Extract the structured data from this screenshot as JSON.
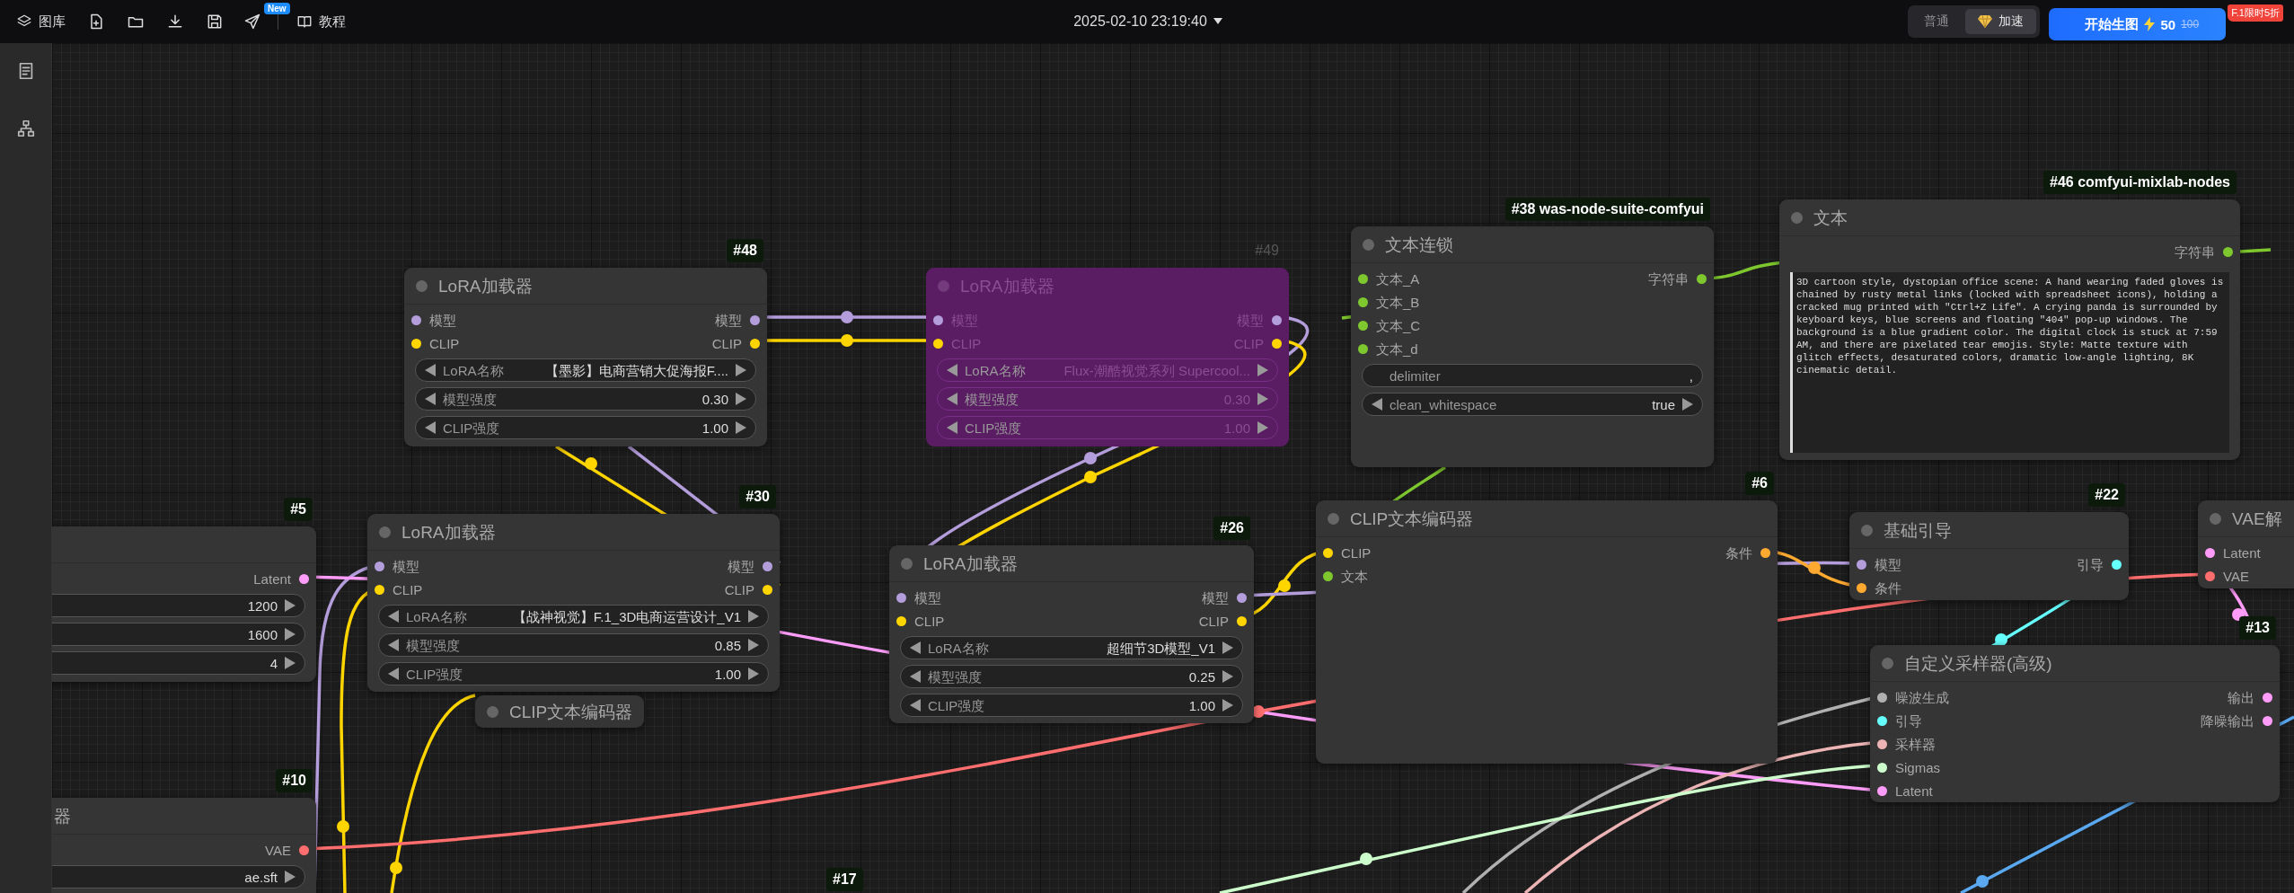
{
  "topbar": {
    "gallery_label": "图库",
    "new_badge": "New",
    "tutorial_label": "教程",
    "datetime": "2025-02-10 23:19:40",
    "modes": [
      {
        "label": "普通",
        "selected": false
      },
      {
        "label": "加速",
        "selected": true
      }
    ],
    "generate": {
      "label": "开始生图",
      "cost": "50",
      "old_cost": "100",
      "promo": "F.1限时5折"
    }
  },
  "nodes": [
    {
      "kind": "standard",
      "badge": "#48",
      "title": "LoRA加载器",
      "bypassed": false,
      "inputs": [
        {
          "label": "模型",
          "color": "#b39ddb"
        },
        {
          "label": "CLIP",
          "color": "#ffd500"
        }
      ],
      "outputs": [
        {
          "label": "模型",
          "color": "#b39ddb"
        },
        {
          "label": "CLIP",
          "color": "#ffd500"
        }
      ],
      "widgets": [
        {
          "kind": "combo",
          "label": "LoRA名称",
          "value": "【墨影】电商营销大促海报F...."
        },
        {
          "kind": "combo",
          "label": "模型强度",
          "value": "0.30"
        },
        {
          "kind": "combo",
          "label": "CLIP强度",
          "value": "1.00"
        }
      ]
    },
    {
      "kind": "standard",
      "badge": "#49",
      "title": "LoRA加载器",
      "bypassed": true,
      "inputs": [
        {
          "label": "模型",
          "color": "#b39ddb"
        },
        {
          "label": "CLIP",
          "color": "#ffd500"
        }
      ],
      "outputs": [
        {
          "label": "模型",
          "color": "#b39ddb"
        },
        {
          "label": "CLIP",
          "color": "#ffd500"
        }
      ],
      "widgets": [
        {
          "kind": "combo",
          "label": "LoRA名称",
          "value": "Flux-潮酷视觉系列 Supercool..."
        },
        {
          "kind": "combo",
          "label": "模型强度",
          "value": "0.30"
        },
        {
          "kind": "combo",
          "label": "CLIP强度",
          "value": "1.00"
        }
      ]
    },
    {
      "kind": "standard",
      "badge": "#38 was-node-suite-comfyui",
      "title": "文本连锁",
      "bypassed": false,
      "inputs": [
        {
          "label": "文本_A",
          "color": "#7ec72f"
        },
        {
          "label": "文本_B",
          "color": "#7ec72f"
        },
        {
          "label": "文本_C",
          "color": "#7ec72f"
        },
        {
          "label": "文本_d",
          "color": "#7ec72f"
        }
      ],
      "outputs": [
        {
          "label": "字符串",
          "color": "#7ec72f"
        }
      ],
      "widgets": [
        {
          "kind": "text",
          "label": "delimiter",
          "value": ","
        },
        {
          "kind": "combo",
          "label": "clean_whitespace",
          "value": "true"
        }
      ]
    },
    {
      "kind": "text",
      "badge": "#46 comfyui-mixlab-nodes",
      "title": "文本",
      "bypassed": false,
      "outputs": [
        {
          "label": "字符串",
          "color": "#7ec72f"
        }
      ],
      "text": "3D cartoon style, dystopian office scene: A hand wearing faded gloves is chained by rusty metal links (locked with spreadsheet icons), holding a cracked mug printed with \"Ctrl+Z Life\". A crying panda is surrounded by keyboard keys, blue screens and floating \"404\" pop-up windows. The background is a blue gradient color. The digital clock is stuck at 7:59 AM, and there are pixelated tear emojis. Style: Matte texture with glitch effects, desaturated colors, dramatic low-angle lighting, 8K cinematic detail."
    },
    {
      "kind": "standard",
      "badge": "#5",
      "bypassed": false,
      "outputs": [
        {
          "label": "Latent",
          "color": "#ff9cf9"
        }
      ],
      "widgets": [
        {
          "kind": "number",
          "value": "1200"
        },
        {
          "kind": "number",
          "value": "1600"
        },
        {
          "kind": "number",
          "value": "4"
        }
      ]
    },
    {
      "kind": "standard",
      "badge": "#30",
      "title": "LoRA加载器",
      "bypassed": false,
      "inputs": [
        {
          "label": "模型",
          "color": "#b39ddb"
        },
        {
          "label": "CLIP",
          "color": "#ffd500"
        }
      ],
      "outputs": [
        {
          "label": "模型",
          "color": "#b39ddb"
        },
        {
          "label": "CLIP",
          "color": "#ffd500"
        }
      ],
      "widgets": [
        {
          "kind": "combo",
          "label": "LoRA名称",
          "value": "【战神视觉】F.1_3D电商运营设计_V1"
        },
        {
          "kind": "combo",
          "label": "模型强度",
          "value": "0.85"
        },
        {
          "kind": "combo",
          "label": "CLIP强度",
          "value": "1.00"
        }
      ]
    },
    {
      "kind": "collapsed",
      "title": "CLIP文本编码器",
      "bypassed": false
    },
    {
      "kind": "standard",
      "badge": "#26",
      "title": "LoRA加载器",
      "bypassed": false,
      "inputs": [
        {
          "label": "模型",
          "color": "#b39ddb"
        },
        {
          "label": "CLIP",
          "color": "#ffd500"
        }
      ],
      "outputs": [
        {
          "label": "模型",
          "color": "#b39ddb"
        },
        {
          "label": "CLIP",
          "color": "#ffd500"
        }
      ],
      "widgets": [
        {
          "kind": "combo",
          "label": "LoRA名称",
          "value": "超细节3D模型_V1"
        },
        {
          "kind": "combo",
          "label": "模型强度",
          "value": "0.25"
        },
        {
          "kind": "combo",
          "label": "CLIP强度",
          "value": "1.00"
        }
      ]
    },
    {
      "kind": "standard",
      "badge": "#6",
      "title": "CLIP文本编码器",
      "bypassed": false,
      "inputs": [
        {
          "label": "CLIP",
          "color": "#ffd500"
        },
        {
          "label": "文本",
          "color": "#7ec72f"
        }
      ],
      "outputs": [
        {
          "label": "条件",
          "color": "#ffa931"
        }
      ]
    },
    {
      "kind": "standard",
      "badge": "#22",
      "title": "基础引导",
      "bypassed": false,
      "inputs": [
        {
          "label": "模型",
          "color": "#b39ddb"
        },
        {
          "label": "条件",
          "color": "#ffa931"
        }
      ],
      "outputs": [
        {
          "label": "引导",
          "color": "#66ffff"
        }
      ]
    },
    {
      "kind": "standard",
      "title": "VAE解",
      "bypassed": false,
      "inputs": [
        {
          "label": "Latent",
          "color": "#ff9cf9"
        },
        {
          "label": "VAE",
          "color": "#ff6e6e"
        }
      ]
    },
    {
      "kind": "standard",
      "badge": "#13",
      "title": "自定义采样器(高级)",
      "bypassed": false,
      "inputs": [
        {
          "label": "噪波生成",
          "color": "#b0b0b0"
        },
        {
          "label": "引导",
          "color": "#66ffff"
        },
        {
          "label": "采样器",
          "color": "#ecb4b4"
        },
        {
          "label": "Sigmas",
          "color": "#cdffcd"
        },
        {
          "label": "Latent",
          "color": "#ff9cf9"
        }
      ],
      "outputs": [
        {
          "label": "输出",
          "color": "#ff9cf9"
        },
        {
          "label": "降噪输出",
          "color": "#ff9cf9"
        }
      ]
    },
    {
      "kind": "standard",
      "badge": "#10",
      "title": "器",
      "bypassed": false,
      "outputs": [
        {
          "label": "VAE",
          "color": "#ff6e6e"
        }
      ],
      "widgets": [
        {
          "kind": "number",
          "value": "ae.sft"
        }
      ]
    }
  ],
  "offscreen_badges": [
    "#17"
  ]
}
